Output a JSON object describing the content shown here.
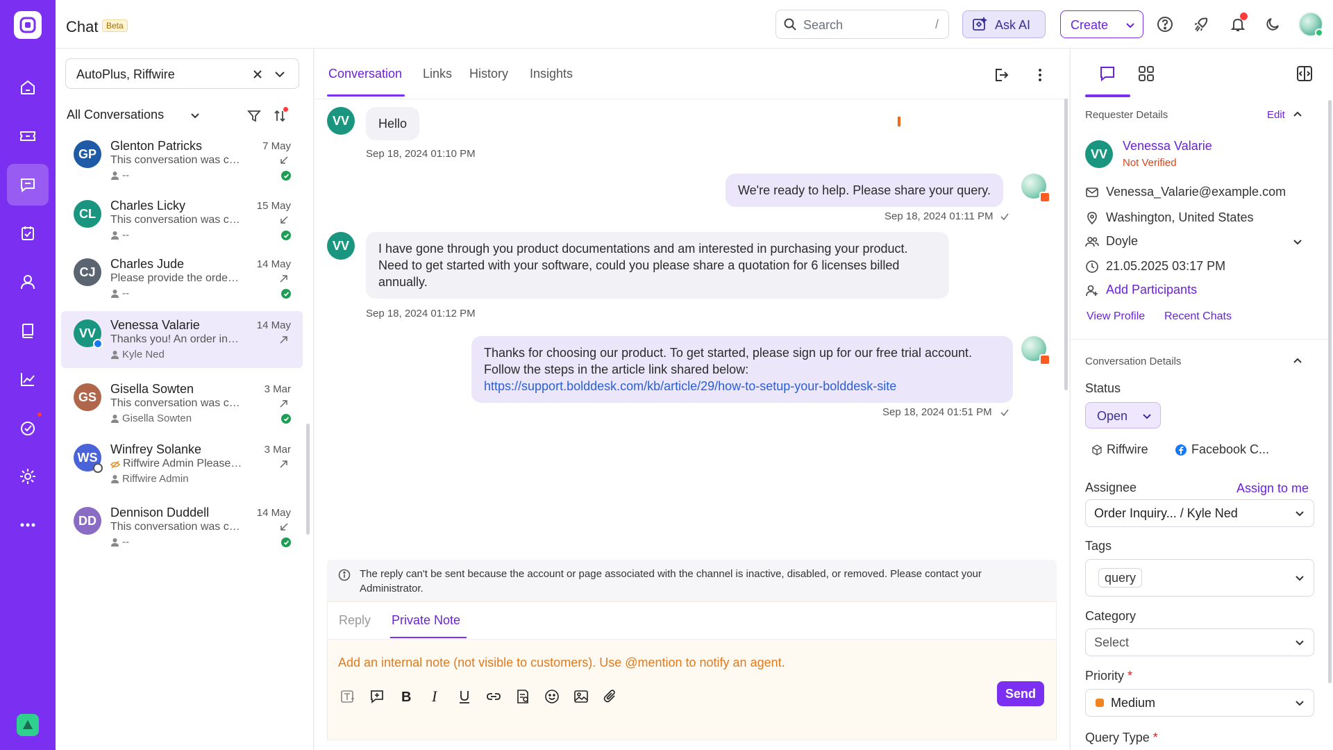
{
  "app": {
    "title": "Chat",
    "beta_badge": "Beta"
  },
  "topbar": {
    "search_placeholder": "Search",
    "search_shortcut": "/",
    "ask_ai_label": "Ask AI",
    "create_label": "Create",
    "icons": [
      "help-icon",
      "rocket-icon",
      "bell-icon",
      "moon-icon"
    ]
  },
  "nav": {
    "items": [
      "home-icon",
      "ticket-icon",
      "chat-icon",
      "tasks-icon",
      "contacts-icon",
      "knowledge-base-icon",
      "reports-icon",
      "activity-icon",
      "settings-icon",
      "more-icon"
    ],
    "active": "chat-icon"
  },
  "left": {
    "filter_value": "AutoPlus, Riffwire",
    "scope_label": "All Conversations",
    "conversations": [
      {
        "initials": "GP",
        "name": "Glenton Patricks",
        "date": "7 May",
        "preview": "This conversation was clos...",
        "agent": "--",
        "color": "#1f5aa6",
        "dir": "in",
        "resolved": true
      },
      {
        "initials": "CL",
        "name": "Charles Licky",
        "date": "15 May",
        "preview": "This conversation was clos...",
        "agent": "--",
        "color": "#1a9680",
        "dir": "in",
        "resolved": true
      },
      {
        "initials": "CJ",
        "name": "Charles Jude",
        "date": "14 May",
        "preview": "Please provide the order nu...",
        "agent": "--",
        "color": "#5b6572",
        "dir": "out",
        "resolved": true
      },
      {
        "initials": "VV",
        "name": "Venessa Valarie",
        "date": "14 May",
        "preview": "Thanks you! An order inquir...",
        "agent": "Kyle Ned",
        "color": "#1a9680",
        "dir": "out",
        "resolved": false
      },
      {
        "initials": "GS",
        "name": "Gisella Sowten",
        "date": "3 Mar",
        "preview": "This conversation was clos...",
        "agent": "Gisella Sowten",
        "color": "#b0664a",
        "dir": "out",
        "resolved": true
      },
      {
        "initials": "WS",
        "name": "Winfrey Solanke",
        "date": "3 Mar",
        "preview": "Riffwire Admin Please ch...",
        "agent": "Riffwire Admin",
        "color": "#4a63d8",
        "dir": "out",
        "resolved": false
      },
      {
        "initials": "DD",
        "name": "Dennison Duddell",
        "date": "14 May",
        "preview": "This conversation was clos...",
        "agent": "--",
        "color": "#8b6cc4",
        "dir": "in",
        "resolved": true
      }
    ]
  },
  "center": {
    "tabs": [
      "Conversation",
      "Links",
      "History",
      "Insights"
    ],
    "active_tab": "Conversation",
    "messages": [
      {
        "from": "customer",
        "initials": "VV",
        "text": "Hello",
        "time": "Sep 18, 2024 01:10 PM"
      },
      {
        "from": "agent",
        "text": "We're ready to help. Please share your query.",
        "time": "Sep 18, 2024 01:11 PM"
      },
      {
        "from": "customer",
        "initials": "VV",
        "lines": [
          "I have gone through you product documentations and am interested in purchasing your product.",
          "Need to get started with your software, could you please share a quotation for 6 licenses billed",
          "annually."
        ],
        "time": "Sep 18, 2024 01:12 PM"
      },
      {
        "from": "agent",
        "lines": [
          "Thanks for choosing our product. To get started, please sign up for our free trial account.",
          "Follow the steps in the article link shared below:"
        ],
        "link": "https://support.bolddesk.com/kb/article/29/how-to-setup-your-bolddesk-site",
        "time": "Sep 18, 2024 01:51 PM"
      }
    ],
    "notice": "The reply can't be sent because the account or page associated with the channel is inactive, disabled, or removed. Please contact your Administrator.",
    "composer": {
      "tabs": [
        "Reply",
        "Private Note"
      ],
      "active_tab": "Private Note",
      "placeholder": "Add an internal note (not visible to customers). Use @mention to notify an agent.",
      "send_label": "Send"
    }
  },
  "right": {
    "requester_section": "Requester Details",
    "edit_label": "Edit",
    "requester": {
      "initials": "VV",
      "name": "Venessa Valarie",
      "verification": "Not Verified",
      "email": "Venessa_Valarie@example.com",
      "location": "Washington, United States",
      "group": "Doyle",
      "datetime": "21.05.2025 03:17 PM",
      "add_participants": "Add Participants"
    },
    "view_profile": "View Profile",
    "recent_chats": "Recent Chats",
    "conversation_section": "Conversation Details",
    "status_label": "Status",
    "status_value": "Open",
    "brand_chip": "Riffwire",
    "channel_chip": "Facebook C...",
    "assignee_label": "Assignee",
    "assign_to_me": "Assign to me",
    "assignee_value": "Order Inquiry...  / Kyle Ned",
    "tags_label": "Tags",
    "tag_value": "query",
    "category_label": "Category",
    "category_value": "Select",
    "priority_label": "Priority",
    "priority_value": "Medium",
    "query_type_label": "Query Type",
    "required_mark": "*"
  }
}
